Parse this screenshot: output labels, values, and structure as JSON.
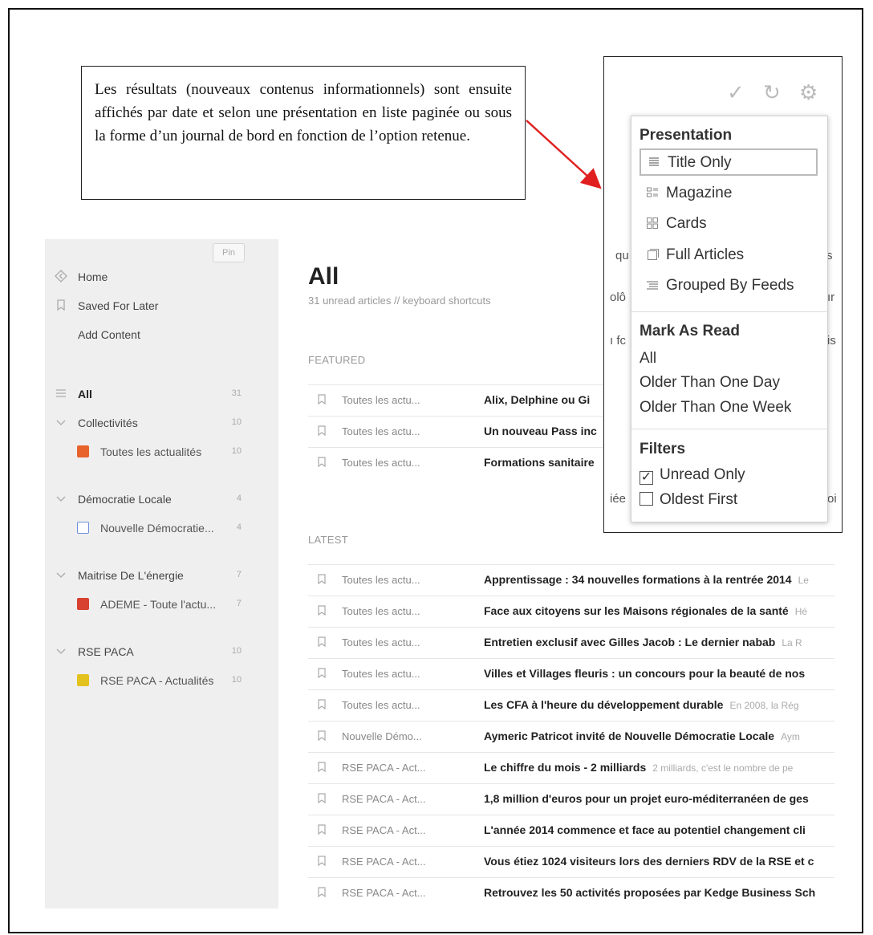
{
  "annotation": {
    "text": "Les résultats (nouveaux contenus informationnels) sont ensuite affichés par date et selon une présentation en liste paginée ou sous la forme d’un journal de bord en fonction de l’option retenue."
  },
  "sidebar": {
    "pin_label": "Pin",
    "nav": [
      {
        "label": "Home",
        "icon": "home-icon"
      },
      {
        "label": "Saved For Later",
        "icon": "bookmark-icon"
      },
      {
        "label": "Add Content",
        "icon": ""
      }
    ],
    "all": {
      "label": "All",
      "count": "31"
    },
    "categories": [
      {
        "label": "Collectivités",
        "count": "10",
        "feeds": [
          {
            "label": "Toutes les actualités",
            "count": "10",
            "color": "#e8632b"
          }
        ]
      },
      {
        "label": "Démocratie Locale",
        "count": "4",
        "feeds": [
          {
            "label": "Nouvelle Démocratie...",
            "count": "4",
            "color": "#6a8fd8"
          }
        ]
      },
      {
        "label": "Maitrise De L'énergie",
        "count": "7",
        "feeds": [
          {
            "label": "ADEME - Toute l'actu...",
            "count": "7",
            "color": "#d8402f"
          }
        ]
      },
      {
        "label": "RSE PACA",
        "count": "10",
        "feeds": [
          {
            "label": "RSE PACA - Actualités",
            "count": "10",
            "color": "#e3c21d"
          }
        ]
      }
    ]
  },
  "main": {
    "title": "All",
    "subtitle": "31 unread articles  //  keyboard shortcuts",
    "featured_label": "FEATURED",
    "latest_label": "LATEST",
    "featured": [
      {
        "source": "Toutes les actu...",
        "title": "Alix, Delphine ou Gi",
        "snippet": ""
      },
      {
        "source": "Toutes les actu...",
        "title": "Un nouveau Pass inc",
        "snippet": ""
      },
      {
        "source": "Toutes les actu...",
        "title": "Formations sanitaire",
        "snippet": ""
      }
    ],
    "latest": [
      {
        "source": "Toutes les actu...",
        "title": "Apprentissage : 34 nouvelles formations à la rentrée 2014",
        "snippet": "Le"
      },
      {
        "source": "Toutes les actu...",
        "title": "Face aux citoyens sur les Maisons régionales de la santé",
        "snippet": "Hé"
      },
      {
        "source": "Toutes les actu...",
        "title": "Entretien exclusif avec Gilles Jacob : Le dernier nabab",
        "snippet": "La R"
      },
      {
        "source": "Toutes les actu...",
        "title": "Villes et Villages fleuris : un concours pour la beauté de nos",
        "snippet": ""
      },
      {
        "source": "Toutes les actu...",
        "title": "Les CFA à l'heure du développement durable",
        "snippet": "En 2008, la Rég"
      },
      {
        "source": "Nouvelle Démo...",
        "title": "Aymeric Patricot invité de Nouvelle Démocratie Locale",
        "snippet": "Aym"
      },
      {
        "source": "RSE PACA - Act...",
        "title": "Le chiffre du mois - 2 milliards",
        "snippet": "2 milliards, c'est le nombre de pe"
      },
      {
        "source": "RSE PACA - Act...",
        "title": "1,8 million d'euros pour un projet euro-méditerranéen de ges",
        "snippet": ""
      },
      {
        "source": "RSE PACA - Act...",
        "title": "L'année 2014 commence et face au potentiel changement cli",
        "snippet": ""
      },
      {
        "source": "RSE PACA - Act...",
        "title": "Vous étiez 1024 visiteurs lors des derniers RDV de la RSE et c",
        "snippet": ""
      },
      {
        "source": "RSE PACA - Act...",
        "title": "Retrouvez les 50 activités proposées par Kedge Business Sch",
        "snippet": ""
      }
    ]
  },
  "toolbar": {
    "icons": [
      "checkmark-icon",
      "refresh-icon",
      "gear-icon"
    ]
  },
  "background_fragments": [
    "qu",
    "s",
    "olô",
    "ır",
    "ı fc",
    "is",
    "iée",
    "oi"
  ],
  "menu": {
    "presentation_header": "Presentation",
    "presentation_options": [
      {
        "label": "Title Only",
        "icon": "title-only-icon",
        "selected": true
      },
      {
        "label": "Magazine",
        "icon": "magazine-icon",
        "selected": false
      },
      {
        "label": "Cards",
        "icon": "cards-icon",
        "selected": false
      },
      {
        "label": "Full Articles",
        "icon": "full-articles-icon",
        "selected": false
      },
      {
        "label": "Grouped By Feeds",
        "icon": "grouped-feeds-icon",
        "selected": false
      }
    ],
    "mark_header": "Mark As Read",
    "mark_options": [
      "All",
      "Older Than One Day",
      "Older Than One Week"
    ],
    "filters_header": "Filters",
    "filters": [
      {
        "label": "Unread Only",
        "checked": true
      },
      {
        "label": "Oldest First",
        "checked": false
      }
    ]
  },
  "colors": {
    "sidebar_bg": "#efefef",
    "arrow": "#e02020",
    "accent_text": "#222222"
  }
}
